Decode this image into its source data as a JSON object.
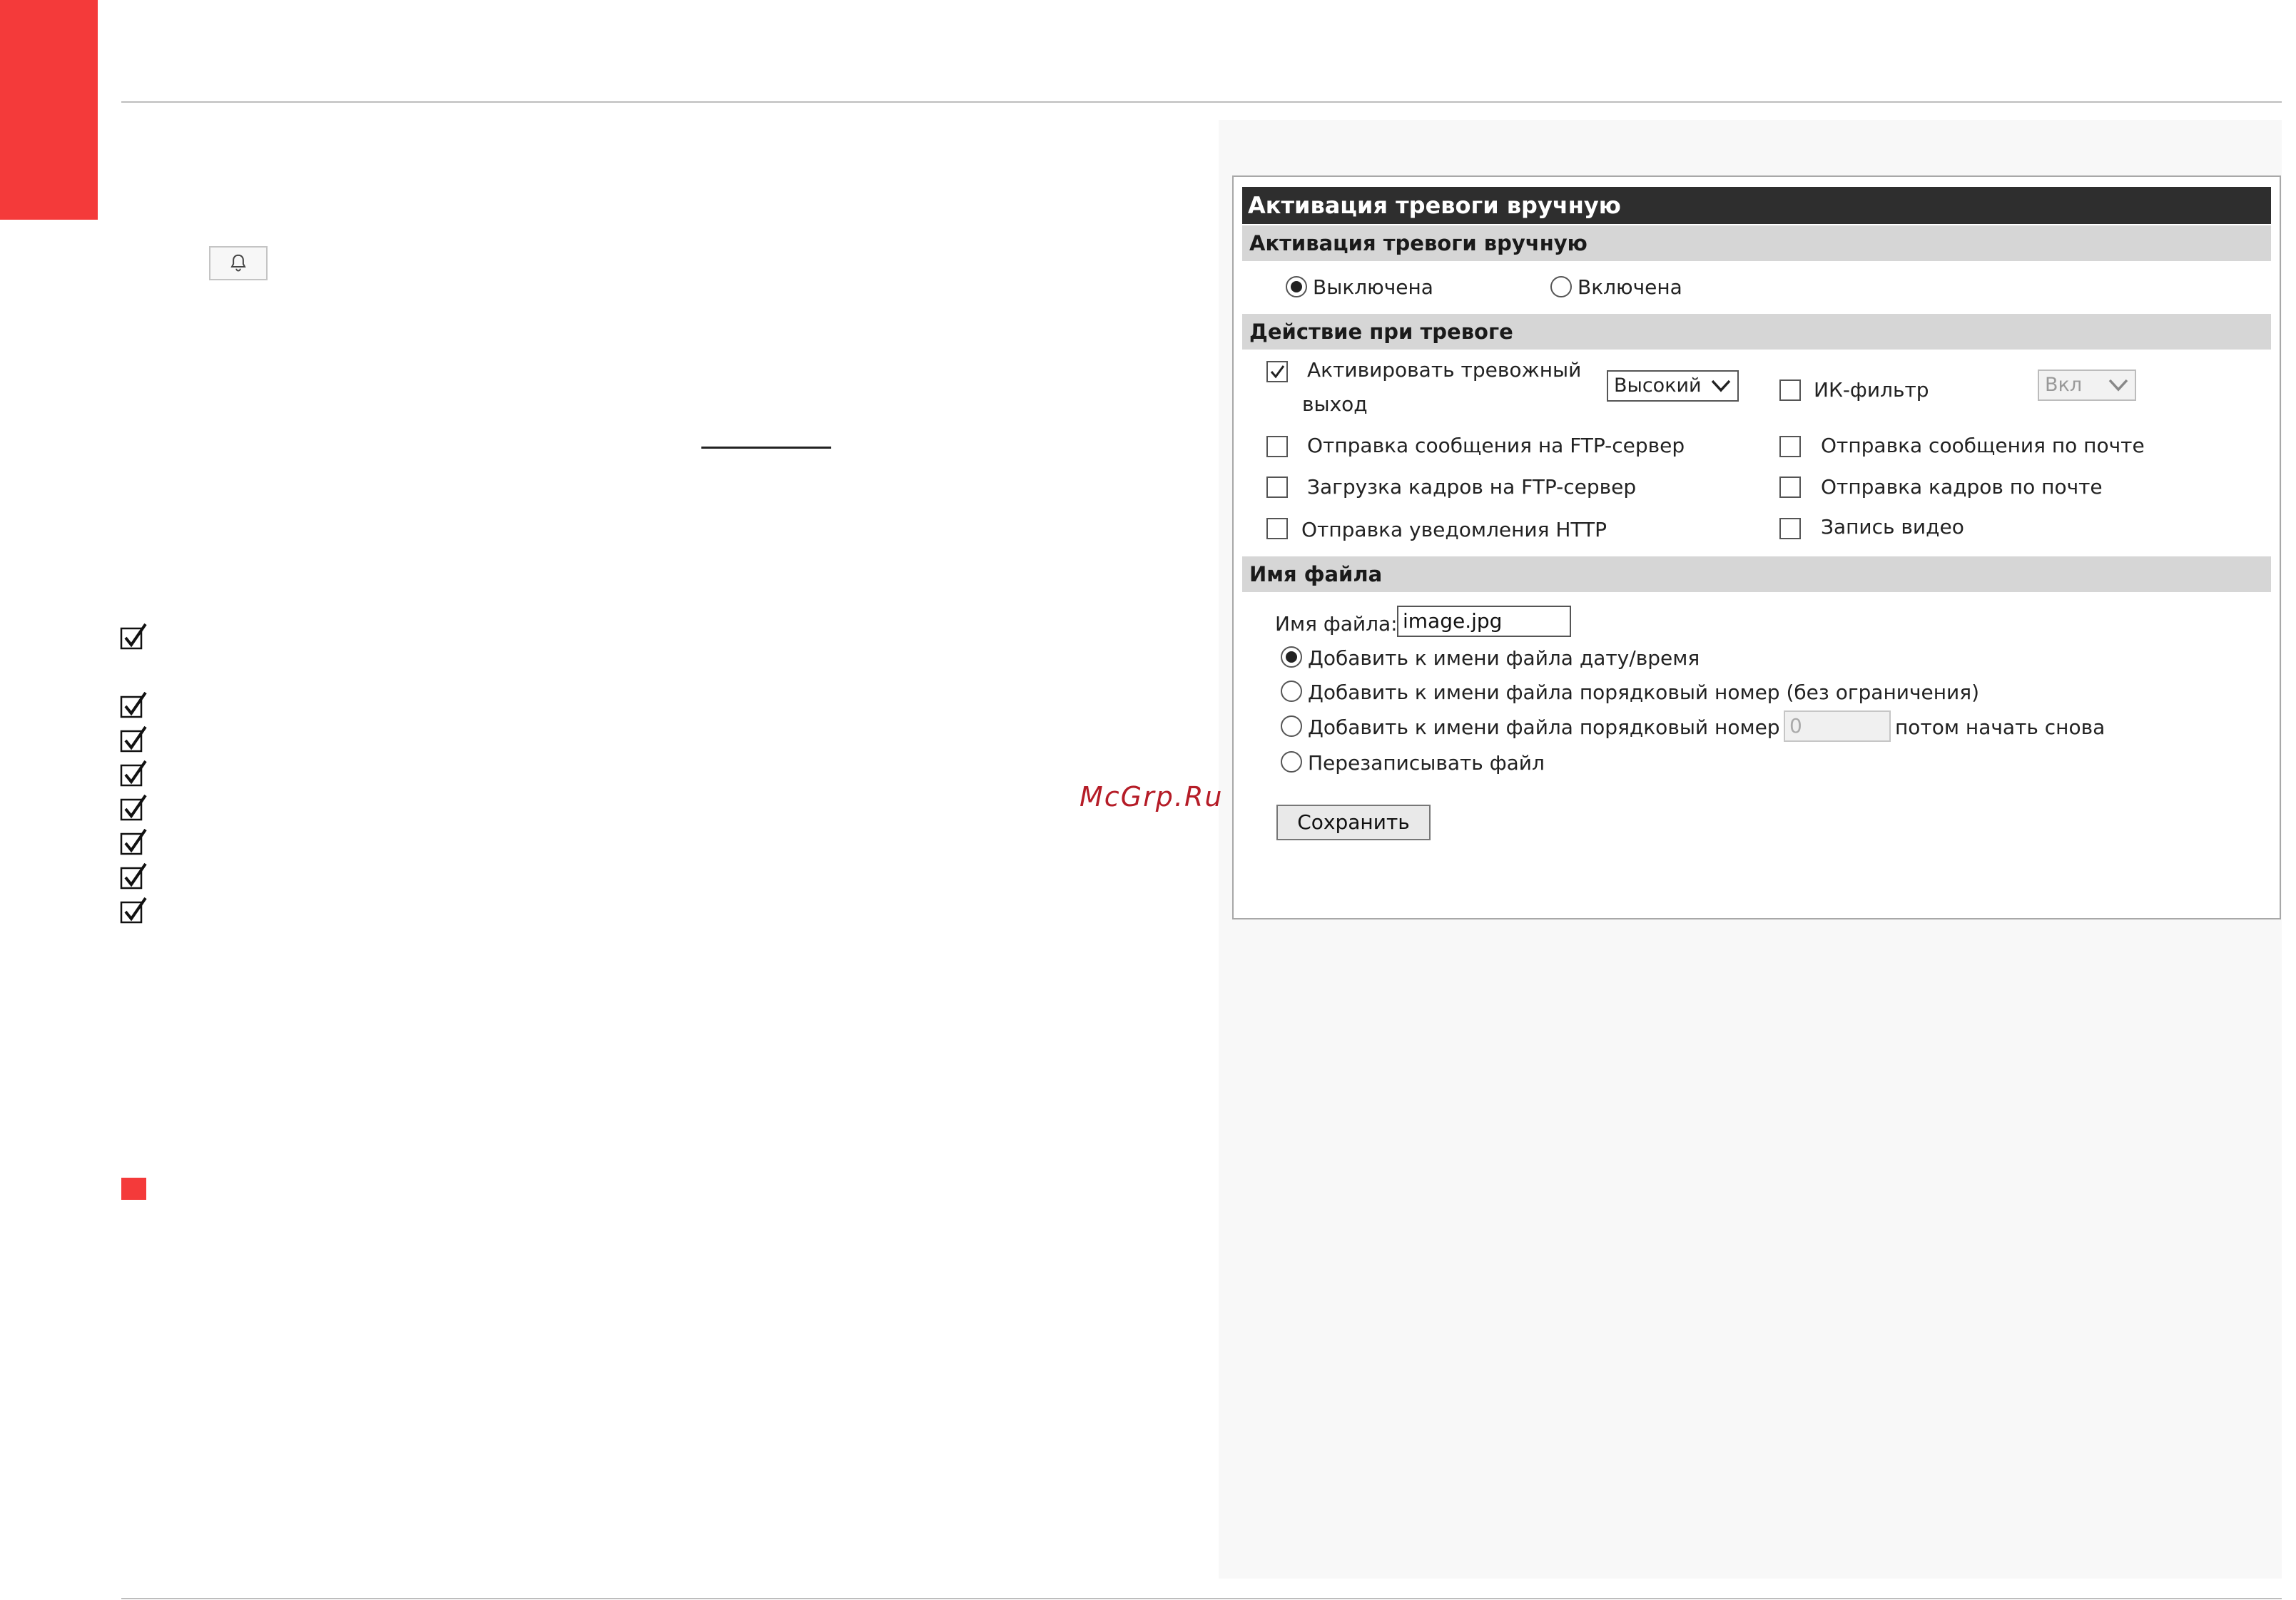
{
  "watermark": "McGrp.Ru",
  "icons": {
    "bell_button": "bell-icon",
    "checklist": "checkmark-icon"
  },
  "colors": {
    "accent_red": "#f43a3a",
    "panel_title_bg": "#2e2e2e",
    "section_bg": "#d6d6d6",
    "watermark": "#b51c27"
  },
  "checklist_count": 8,
  "panel": {
    "title": "Активация тревоги вручную",
    "manual_section": {
      "header": "Активация тревоги вручную",
      "options": [
        {
          "label": "Выключена",
          "selected": true
        },
        {
          "label": "Включена",
          "selected": false
        }
      ]
    },
    "action_section": {
      "header": "Действие при тревоге",
      "alarm_output": {
        "label_line1": "Активировать тревожный",
        "label_line2": "выход",
        "checked": true,
        "select_value": "Высокий"
      },
      "ir_filter": {
        "label": "ИК-фильтр",
        "checked": false,
        "select_value": "Вкл"
      },
      "items": [
        {
          "label": "Отправка сообщения на FTP-сервер",
          "checked": false
        },
        {
          "label": "Отправка сообщения по почте",
          "checked": false
        },
        {
          "label": "Загрузка кадров на FTP-сервер",
          "checked": false
        },
        {
          "label": "Отправка кадров по почте",
          "checked": false
        },
        {
          "label": "Отправка уведомления HTTP",
          "checked": false
        },
        {
          "label": "Запись видео",
          "checked": false
        }
      ]
    },
    "filename_section": {
      "header": "Имя файла",
      "filename_label": "Имя файла:",
      "filename_value": "image.jpg",
      "options": [
        {
          "label": "Добавить к имени файла дату/время",
          "selected": true
        },
        {
          "label": "Добавить к имени файла порядковый номер (без ограничения)",
          "selected": false
        },
        {
          "label": "Добавить к имени файла порядковый номер до",
          "selected": false
        },
        {
          "label": "Перезаписывать файл",
          "selected": false
        }
      ],
      "limit_value": "0",
      "limit_suffix": "потом начать снова"
    },
    "save_label": "Сохранить"
  }
}
